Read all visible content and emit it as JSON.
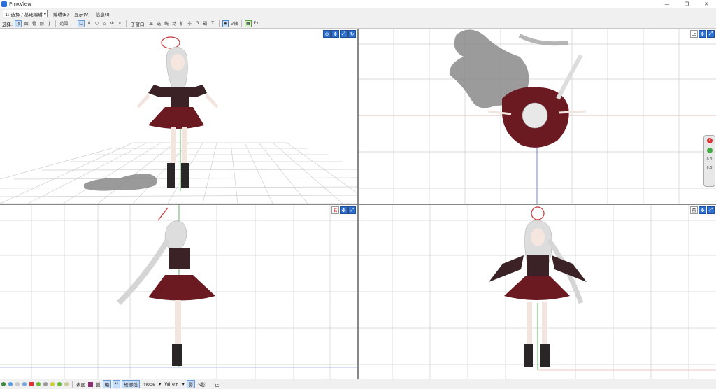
{
  "window": {
    "title": "PmxView",
    "minimize": "—",
    "maximize": "❐",
    "close": "✕"
  },
  "menubar": {
    "mode": "1: 选择 / 基础编辑",
    "items": [
      "编辑(E)",
      "显示(V)",
      "信息(I)"
    ]
  },
  "toolbar": {
    "select_label": "选择:",
    "select_items": [
      "顶",
      "面",
      "骨",
      "刚",
      "J"
    ],
    "range_label": "范围",
    "shape_items": [
      "·",
      "□",
      "δ",
      "○",
      "△",
      "Φ",
      "×"
    ],
    "sub_label": "子窗口:",
    "sub_items": [
      "显",
      "选",
      "统",
      "动",
      "扩",
      "非",
      "G",
      "副",
      "T"
    ],
    "vaxis_label": "V轴",
    "fx_label": "Fx"
  },
  "viewports": {
    "top_right_label": "上",
    "bottom_left_label": "右",
    "bottom_right_label": "前"
  },
  "side_panel": {
    "badge": "1",
    "val1": "0.0",
    "val2": "0.0"
  },
  "statusbar": {
    "items": [
      "表面",
      "仮",
      "軸",
      "¹⁰",
      "轮廓线",
      "mode",
      "Wire+",
      "影",
      "S影",
      "正"
    ]
  },
  "colors": {
    "accent": "#2f6fd0",
    "skirt": "#6b1a22",
    "grid": "#c8c8c8"
  }
}
